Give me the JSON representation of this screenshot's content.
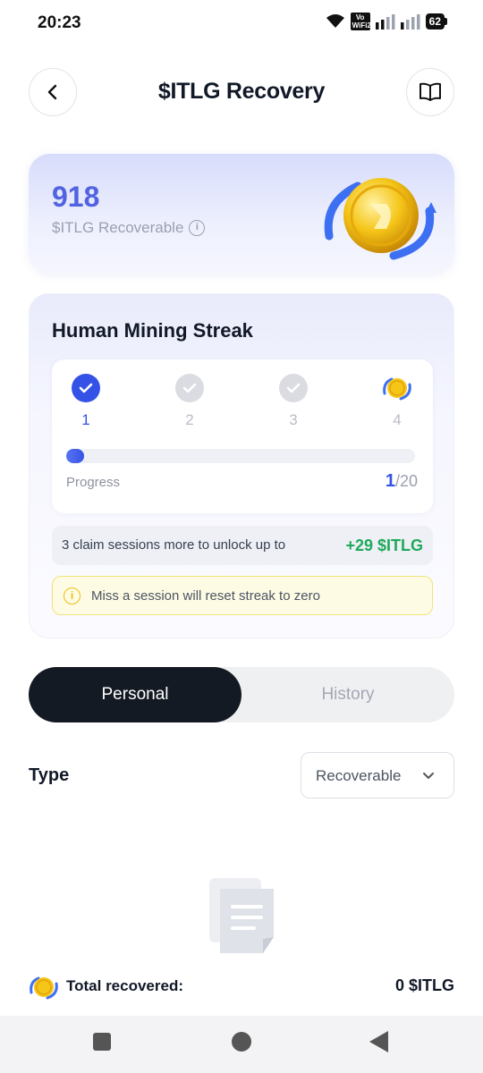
{
  "status_bar": {
    "time": "20:23",
    "volte_line1": "Vo",
    "volte_line2": "WiFi2",
    "battery": "62"
  },
  "header": {
    "title": "$ITLG Recovery",
    "back_icon": "chevron-left-icon",
    "guide_icon": "book-icon"
  },
  "recoverable": {
    "amount": "918",
    "label": "$ITLG Recoverable"
  },
  "streak": {
    "title": "Human Mining Streak",
    "steps": [
      {
        "number": "1",
        "state": "done"
      },
      {
        "number": "2",
        "state": "pending"
      },
      {
        "number": "3",
        "state": "pending"
      },
      {
        "number": "4",
        "state": "reward"
      }
    ],
    "progress_label": "Progress",
    "progress_current": "1",
    "progress_total": "/20",
    "progress_fraction": 0.05,
    "unlock_text": "3 claim sessions more to unlock up to",
    "unlock_reward": "+29 $ITLG",
    "warning": "Miss a session will reset streak to zero"
  },
  "tabs": {
    "active": "Personal",
    "inactive": "History"
  },
  "filter": {
    "label": "Type",
    "selected": "Recoverable"
  },
  "total": {
    "label": "Total recovered:",
    "value": "0 $ITLG"
  },
  "colors": {
    "accent": "#3552e6",
    "reward_green": "#1ea95b",
    "warning_yellow": "#e8bf10",
    "dark": "#141a23"
  }
}
